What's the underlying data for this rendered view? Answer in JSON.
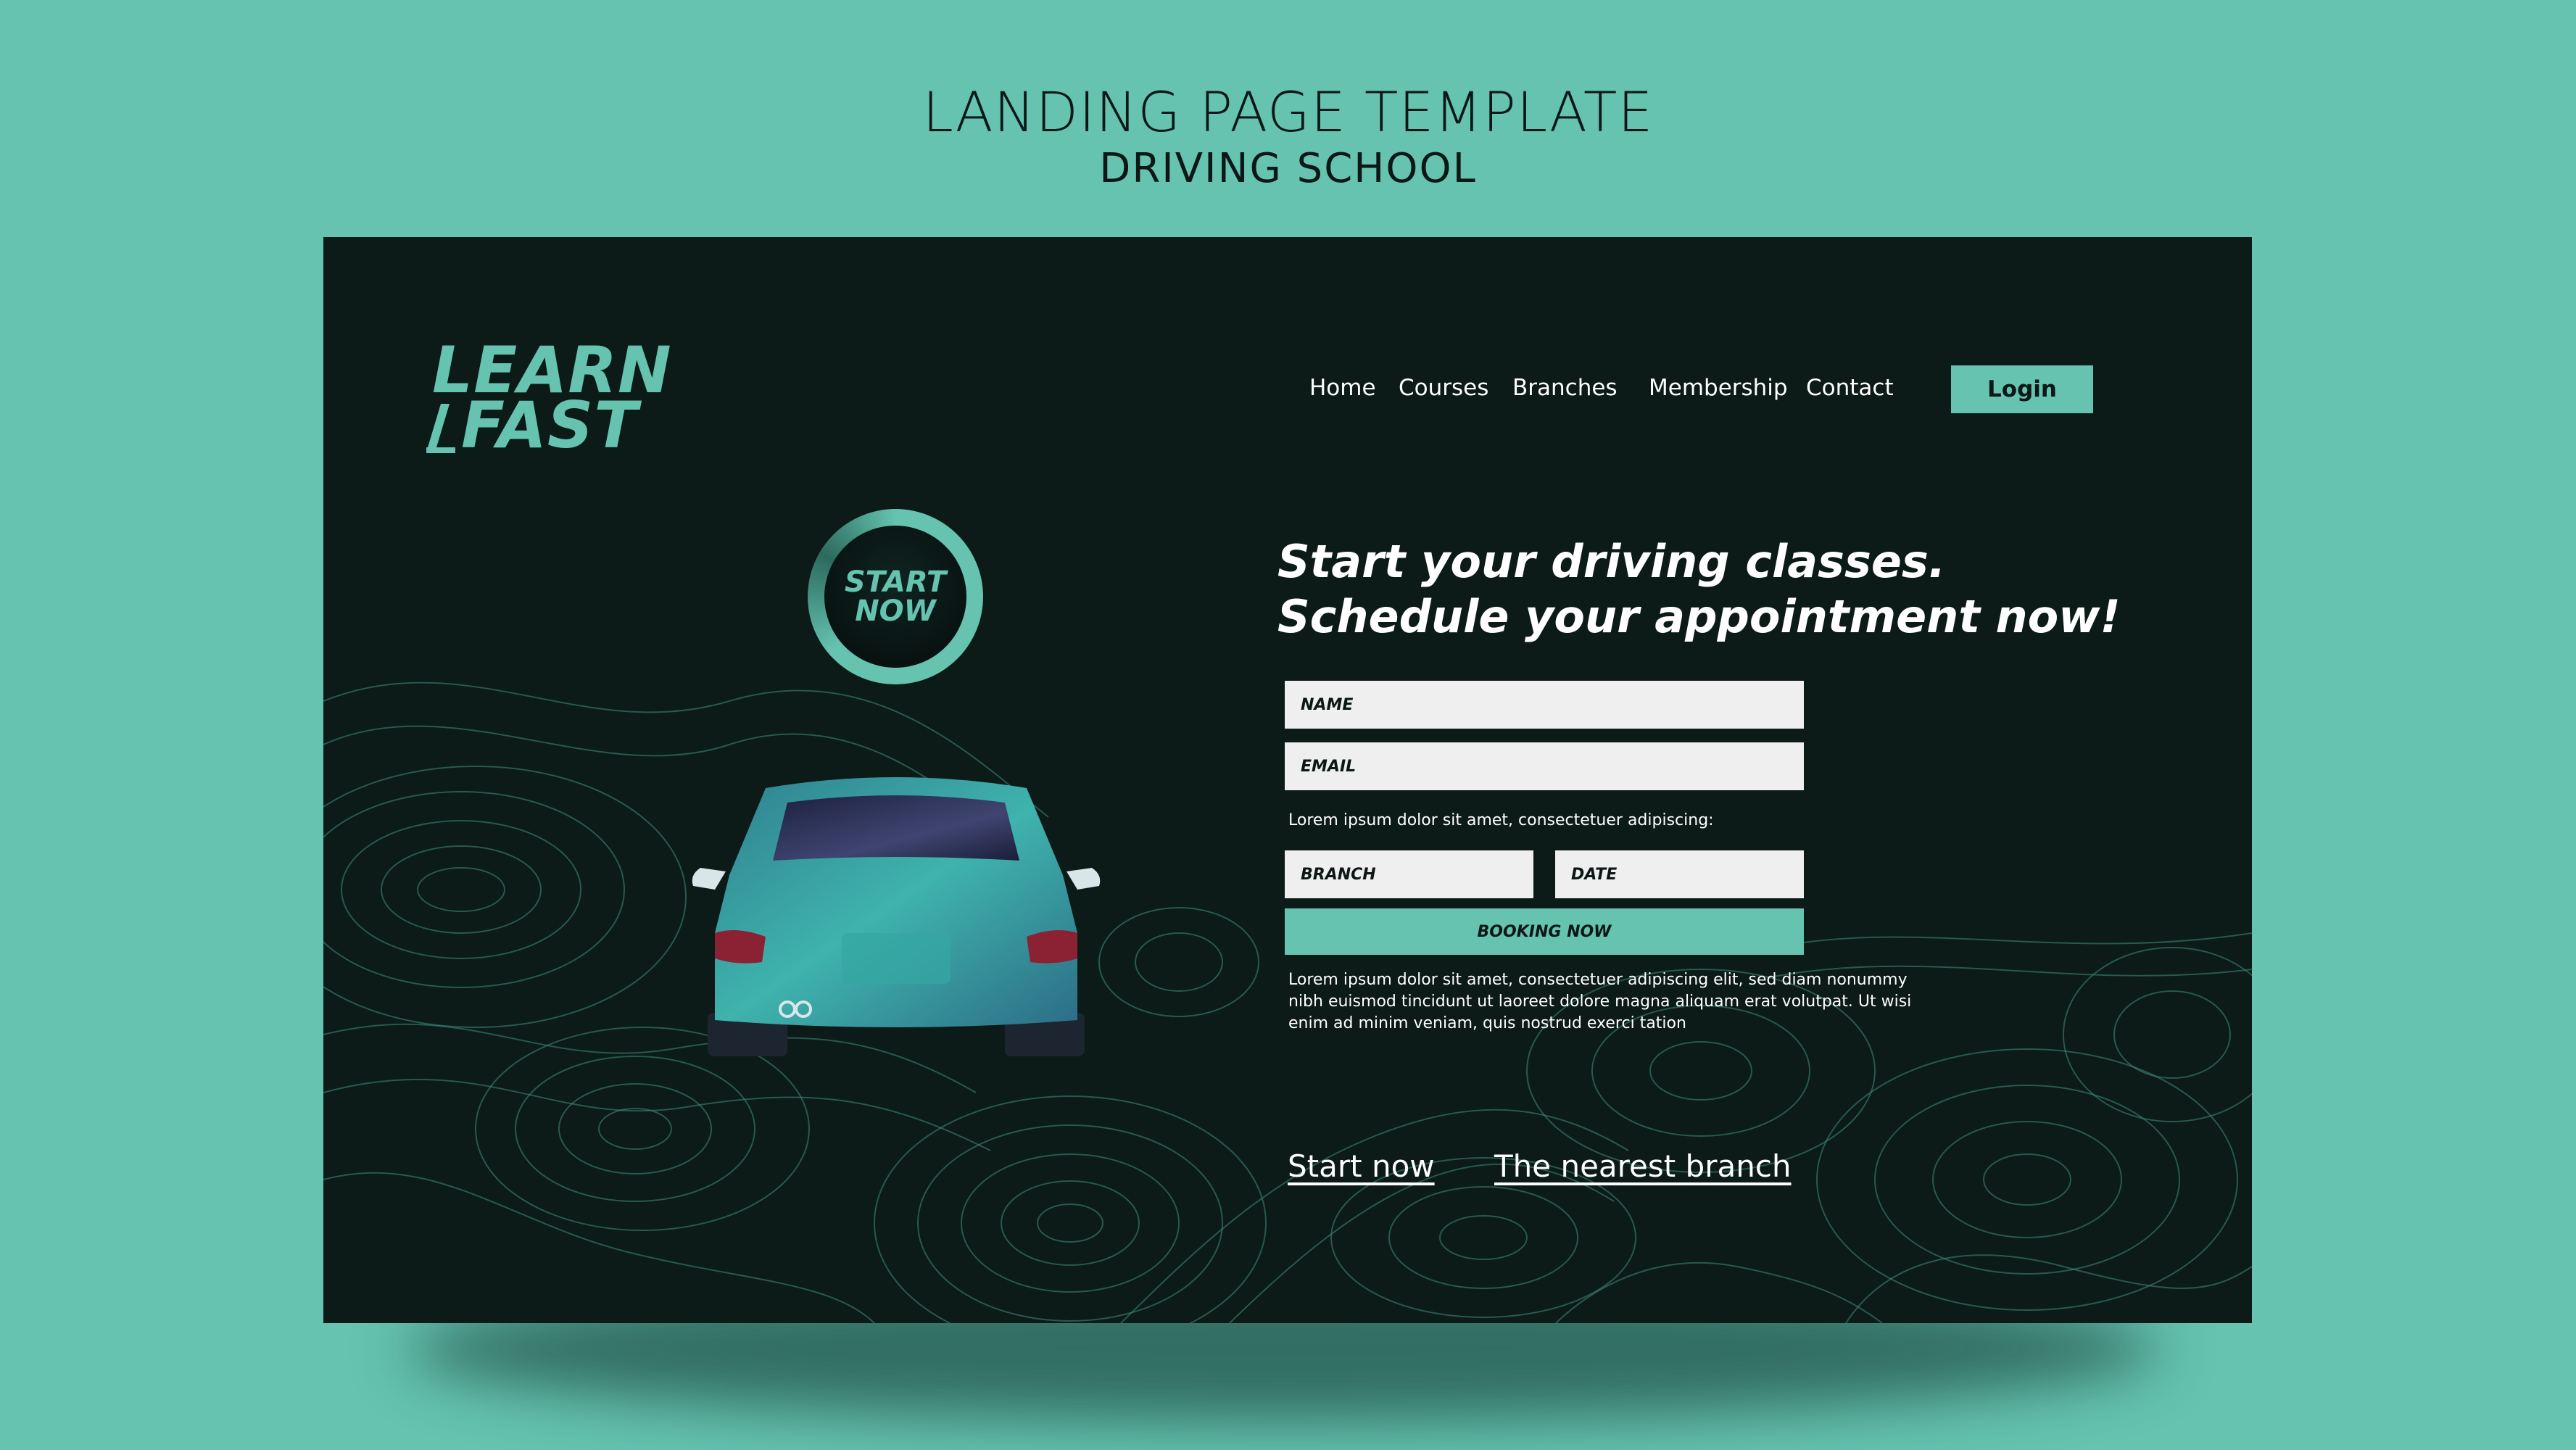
{
  "template": {
    "title": "LANDING PAGE TEMPLATE",
    "subtitle": "DRIVING SCHOOL"
  },
  "brand": {
    "logo_line1": "LEARN",
    "logo_line2": "FAST",
    "accent_color": "#65c3b0",
    "background_color": "#0c1a18"
  },
  "nav": {
    "items": [
      {
        "label": "Home"
      },
      {
        "label": "Courses"
      },
      {
        "label": "Branches"
      },
      {
        "label": "Membership"
      },
      {
        "label": "Contact"
      }
    ],
    "login_label": "Login"
  },
  "badge": {
    "line1": "START",
    "line2": "NOW"
  },
  "hero": {
    "headline_line1": "Start your driving classes.",
    "headline_line2": "Schedule your appointment now!"
  },
  "form": {
    "name_placeholder": "NAME",
    "email_placeholder": "EMAIL",
    "note": "Lorem ipsum dolor sit amet, consectetuer adipiscing:",
    "branch_placeholder": "BRANCH",
    "date_placeholder": "DATE",
    "booking_label": "BOOKING NOW",
    "description": "Lorem ipsum dolor sit amet, consectetuer adipiscing elit, sed diam nonummy nibh euismod tincidunt ut  laoreet dolore magna aliquam erat volutpat. Ut wisi enim ad minim veniam, quis nostrud exerci tation"
  },
  "links": {
    "start_now": "Start now",
    "nearest_branch": "The nearest branch"
  }
}
